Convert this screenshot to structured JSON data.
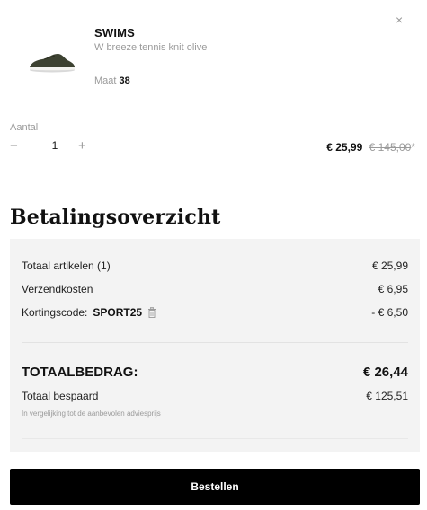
{
  "item": {
    "brand": "SWIMS",
    "description": "W breeze tennis knit olive",
    "size_label": "Maat",
    "size_value": "38",
    "close_icon": "×",
    "quantity_label": "Aantal",
    "quantity_value": "1",
    "minus_glyph": "−",
    "plus_glyph": "+",
    "price_now": "€ 25,99",
    "price_old": "€ 145,00",
    "price_mark": "*"
  },
  "summary": {
    "title": "Betalingsoverzicht",
    "items_label": "Totaal artikelen (1)",
    "items_value": "€ 25,99",
    "shipping_label": "Verzendkosten",
    "shipping_value": "€ 6,95",
    "discount_label": "Kortingscode:",
    "discount_code": "SPORT25",
    "discount_value": "- € 6,50",
    "total_label": "TOTAALBEDRAG:",
    "total_value": "€ 26,44",
    "saved_label": "Totaal bespaard",
    "saved_value": "€ 125,51",
    "saved_note": "In vergelijking tot de aanbevolen adviesprijs"
  },
  "actions": {
    "order_label": "Bestellen"
  },
  "colors": {
    "accent": "#000000",
    "muted": "#9a9a9a",
    "panel": "#f3f3f3",
    "shoe": "#3d4231"
  },
  "icons": {
    "close": "close-icon",
    "trash": "trash-icon",
    "minus": "minus-icon",
    "plus": "plus-icon"
  }
}
